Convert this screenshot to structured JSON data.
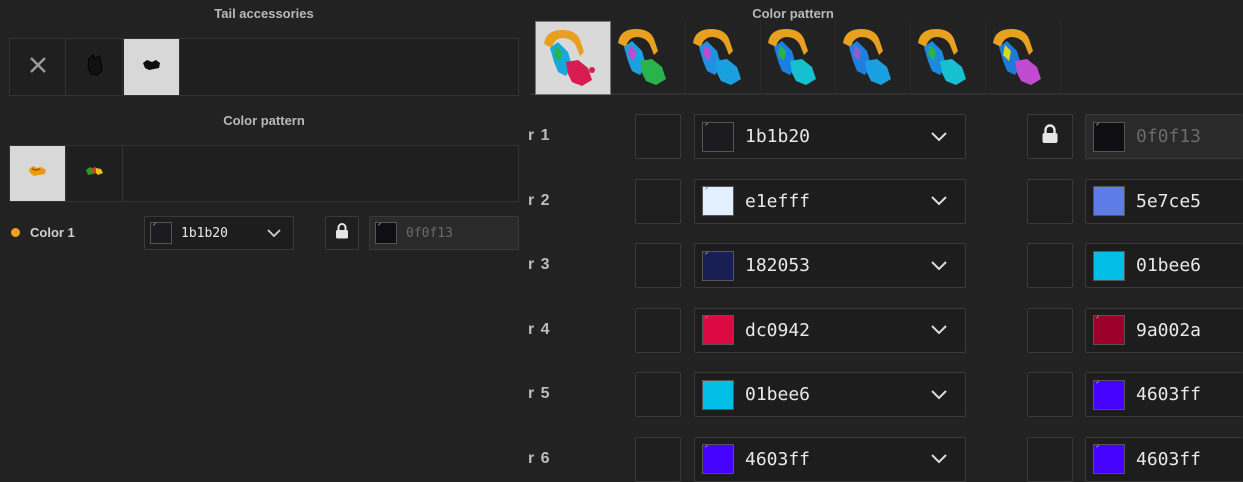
{
  "left": {
    "tail_accessories_title": "Tail accessories",
    "color_pattern_title": "Color pattern",
    "accessories": [
      {
        "icon": "close-icon"
      },
      {
        "icon": "tail-silhouette-icon"
      },
      {
        "icon": "tail-blob-icon",
        "selected": true
      }
    ],
    "patterns": [
      {
        "icon": "orange-pattern-icon",
        "selected": true
      },
      {
        "icon": "multicolor-pattern-icon"
      }
    ],
    "color_row": {
      "dot_color": "#f0a020",
      "label": "Color 1",
      "value": "1b1b20",
      "swatch": "#1b1b20",
      "locked_value": "0f0f13",
      "locked_swatch": "#0f0f13"
    }
  },
  "right": {
    "title": "Color pattern",
    "patterns_count_note": "",
    "rows": [
      {
        "label": "r 1",
        "value": "1b1b20",
        "swatch": "#1b1b20",
        "locked": true,
        "right_value": "0f0f13",
        "right_swatch": "#0f0f13"
      },
      {
        "label": "r 2",
        "value": "e1efff",
        "swatch": "#e1efff",
        "locked": false,
        "right_value": "5e7ce5",
        "right_swatch": "#5e7ce5"
      },
      {
        "label": "r 3",
        "value": "182053",
        "swatch": "#182053",
        "locked": false,
        "right_value": "01bee6",
        "right_swatch": "#01bee6"
      },
      {
        "label": "r 4",
        "value": "dc0942",
        "swatch": "#dc0942",
        "locked": false,
        "right_value": "9a002a",
        "right_swatch": "#9a002a"
      },
      {
        "label": "r 5",
        "value": "01bee6",
        "swatch": "#01bee6",
        "locked": false,
        "right_value": "4603ff",
        "right_swatch": "#4603ff"
      },
      {
        "label": "r 6",
        "value": "4603ff",
        "swatch": "#4603ff",
        "locked": false,
        "right_value": "4603ff",
        "right_swatch": "#4603ff"
      }
    ]
  }
}
